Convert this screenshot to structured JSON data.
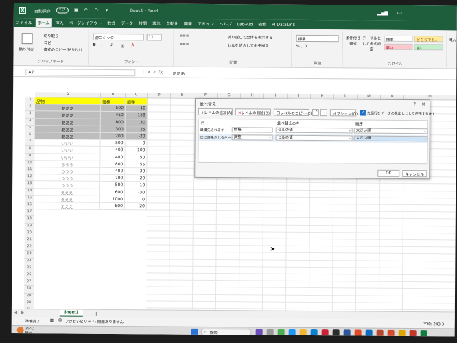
{
  "window": {
    "autosave_label": "自動保存",
    "autosave_state": "オフ",
    "doc_title": "Book1 - Excel"
  },
  "tabs": [
    "ファイル",
    "ホーム",
    "挿入",
    "ページレイアウト",
    "数式",
    "データ",
    "校閲",
    "表示",
    "自動化",
    "開発",
    "アドイン",
    "ヘルプ",
    "Lab-Aid",
    "検索",
    "PI DataLink"
  ],
  "ribbon": {
    "clipboard": {
      "paste": "貼り付け",
      "cut": "切り取り",
      "copy": "コピー",
      "format_painter": "書式のコピー/貼り付け",
      "label": "クリップボード"
    },
    "font": {
      "name": "游ゴシック",
      "size": "11",
      "label": "フォント"
    },
    "alignment": {
      "wrap": "折り返して全体を表示する",
      "merge": "セルを結合して中央揃え",
      "label": "配置"
    },
    "number": {
      "format": "標準",
      "label": "数値"
    },
    "styles": {
      "conditional": "条件付き書式",
      "table": "テーブルとして書式設定",
      "standard": "標準",
      "neutral": "どちらでも...",
      "bad": "悪い",
      "good": "良い",
      "label": "スタイル"
    },
    "insert": "挿入"
  },
  "formula_bar": {
    "name_box": "A2",
    "value": "あああ"
  },
  "columns": [
    "A",
    "B",
    "C",
    "D",
    "E",
    "F",
    "G",
    "H",
    "I",
    "J",
    "K",
    "L",
    "M",
    "N",
    "O"
  ],
  "headers": [
    "品物",
    "価格",
    "調整"
  ],
  "rows": [
    [
      "あああ",
      "500",
      "-10"
    ],
    [
      "あああ",
      "450",
      "158"
    ],
    [
      "あああ",
      "800",
      "30"
    ],
    [
      "あああ",
      "300",
      "25"
    ],
    [
      "あああ",
      "200",
      "-20"
    ],
    [
      "いいい",
      "500",
      "0"
    ],
    [
      "いいい",
      "400",
      "100"
    ],
    [
      "いいい",
      "480",
      "50"
    ],
    [
      "ううう",
      "800",
      "55"
    ],
    [
      "ううう",
      "400",
      "30"
    ],
    [
      "ううう",
      "700",
      "-20"
    ],
    [
      "ううう",
      "500",
      "10"
    ],
    [
      "えええ",
      "600",
      "-30"
    ],
    [
      "えええ",
      "1000",
      "0"
    ],
    [
      "えええ",
      "800",
      "20"
    ]
  ],
  "row_numbers": [
    "1",
    "2",
    "3",
    "4",
    "5",
    "6",
    "7",
    "8",
    "9",
    "10",
    "11",
    "12",
    "13",
    "14",
    "15",
    "16",
    "17",
    "18",
    "19",
    "20",
    "21",
    "22",
    "23",
    "24",
    "25",
    "26",
    "27",
    "28",
    "29",
    "30",
    "31"
  ],
  "dialog": {
    "title": "並べ替え",
    "add_level": "レベルの追加(A)",
    "delete_level": "レベルの削除(D)",
    "copy_level": "レベルのコピー(C)",
    "options": "オプション(O)...",
    "header_checkbox": "先頭行をデータの見出しとして使用する(H)",
    "col_header": "列",
    "key_header": "並べ替えのキー",
    "order_header": "順序",
    "level1_label": "最優先されるキー",
    "level1_column": "価格",
    "level1_key": "セルの値",
    "level1_order": "大きい順",
    "level2_label": "次に優先されるキー",
    "level2_column": "調整",
    "level2_key": "セルの値",
    "level2_order": "大きい順",
    "ok": "OK",
    "cancel": "キャンセル"
  },
  "sheet_tab": "Sheet1",
  "status": {
    "ready": "準備完了",
    "accessibility": "アクセシビリティ: 問題ありません",
    "average": "平均: 243.3"
  },
  "taskbar": {
    "weather_temp": "25°C",
    "weather_desc": "晴れ",
    "search_placeholder": "検索"
  }
}
